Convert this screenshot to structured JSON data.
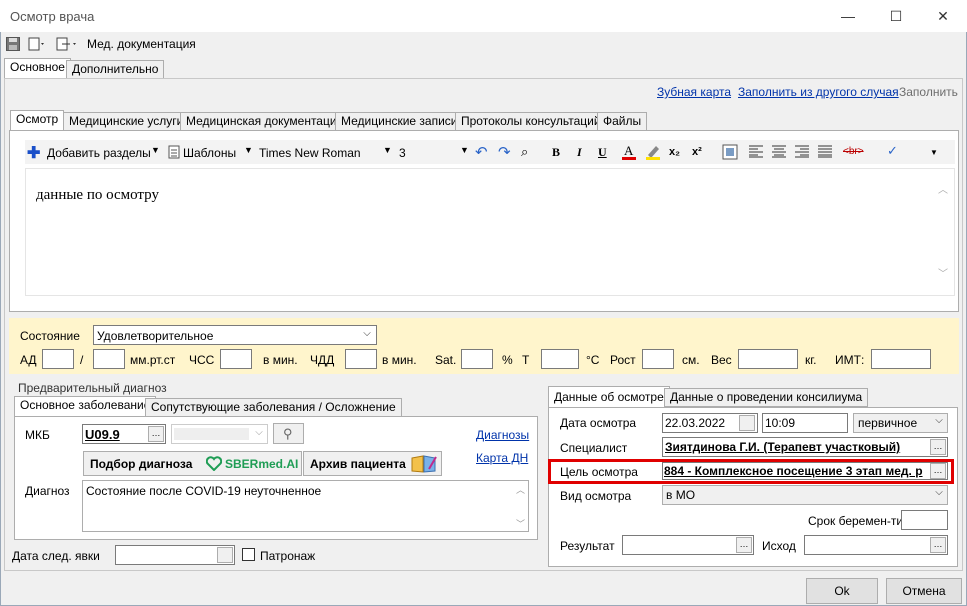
{
  "window": {
    "title": "Осмотр врача",
    "minimize": "—",
    "maximize": "☐",
    "close": "✕"
  },
  "toolbar": {
    "med_docs": "Мед. документация"
  },
  "top_tabs": [
    "Основное",
    "Дополнительно"
  ],
  "links": {
    "dental_chart": "Зубная карта",
    "fill_from_other": "Заполнить из другого случая",
    "fill": "Заполнить"
  },
  "inner_tabs": [
    "Осмотр",
    "Медицинские услуги",
    "Медицинская документация",
    "Медицинские записи",
    "Протоколы консультаций",
    "Файлы"
  ],
  "editor": {
    "add_sections": "Добавить разделы",
    "templates": "Шаблоны",
    "font": "Times New Roman",
    "size": "3",
    "bold": "B",
    "italic": "I",
    "underline": "U",
    "text": "данные по осмотру"
  },
  "vitals": {
    "state_label": "Состояние",
    "state_value": "Удовлетворительное",
    "ad": "АД",
    "slash": "/",
    "mmhg": "мм.рт.ст",
    "chss": "ЧСС",
    "per_min1": "в мин.",
    "chdd": "ЧДД",
    "per_min2": "в мин.",
    "sat": "Sat.",
    "percent": "%",
    "t": "Т",
    "celsius": "°С",
    "height": "Рост",
    "cm": "см.",
    "weight": "Вес",
    "kg": "кг.",
    "imt": "ИМТ:"
  },
  "diagnosis": {
    "group_title": "Предварительный диагноз",
    "tabs": [
      "Основное заболевание",
      "Сопутствующие заболевания / Осложнение"
    ],
    "mkb_label": "МКБ",
    "mkb_value": "U09.9",
    "link_diagnoses": "Диагнозы",
    "link_card_dn": "Карта ДН",
    "pick_button": "Подбор диагноза",
    "sber_logo": "SBERmed.AI",
    "archive_button": "Архив пациента",
    "diag_label": "Диагноз",
    "diag_text": "Состояние после COVID-19 неуточненное"
  },
  "next_visit": {
    "label": "Дата след. явки",
    "patronage": "Патронаж"
  },
  "exam": {
    "tabs": [
      "Данные об осмотре",
      "Данные о проведении консилиума"
    ],
    "date_label": "Дата осмотра",
    "date_value": "22.03.2022",
    "time_value": "10:09",
    "type_value": "первичное",
    "specialist_label": "Специалист",
    "specialist_value": "Зиятдинова Г.И. (Терапевт участковый)",
    "goal_label": "Цель осмотра",
    "goal_value": "884 - Комплексное посещение 3 этап мед. р",
    "kind_label": "Вид осмотра",
    "kind_value": "в МО",
    "pregnancy_label": "Срок беремен-ти",
    "result_label": "Результат",
    "outcome_label": "Исход"
  },
  "footer": {
    "ok": "Ok",
    "cancel": "Отмена"
  },
  "colors": {
    "highlight": "#e00000",
    "link": "#0033aa",
    "vitals_bg": "#fff5cc"
  }
}
